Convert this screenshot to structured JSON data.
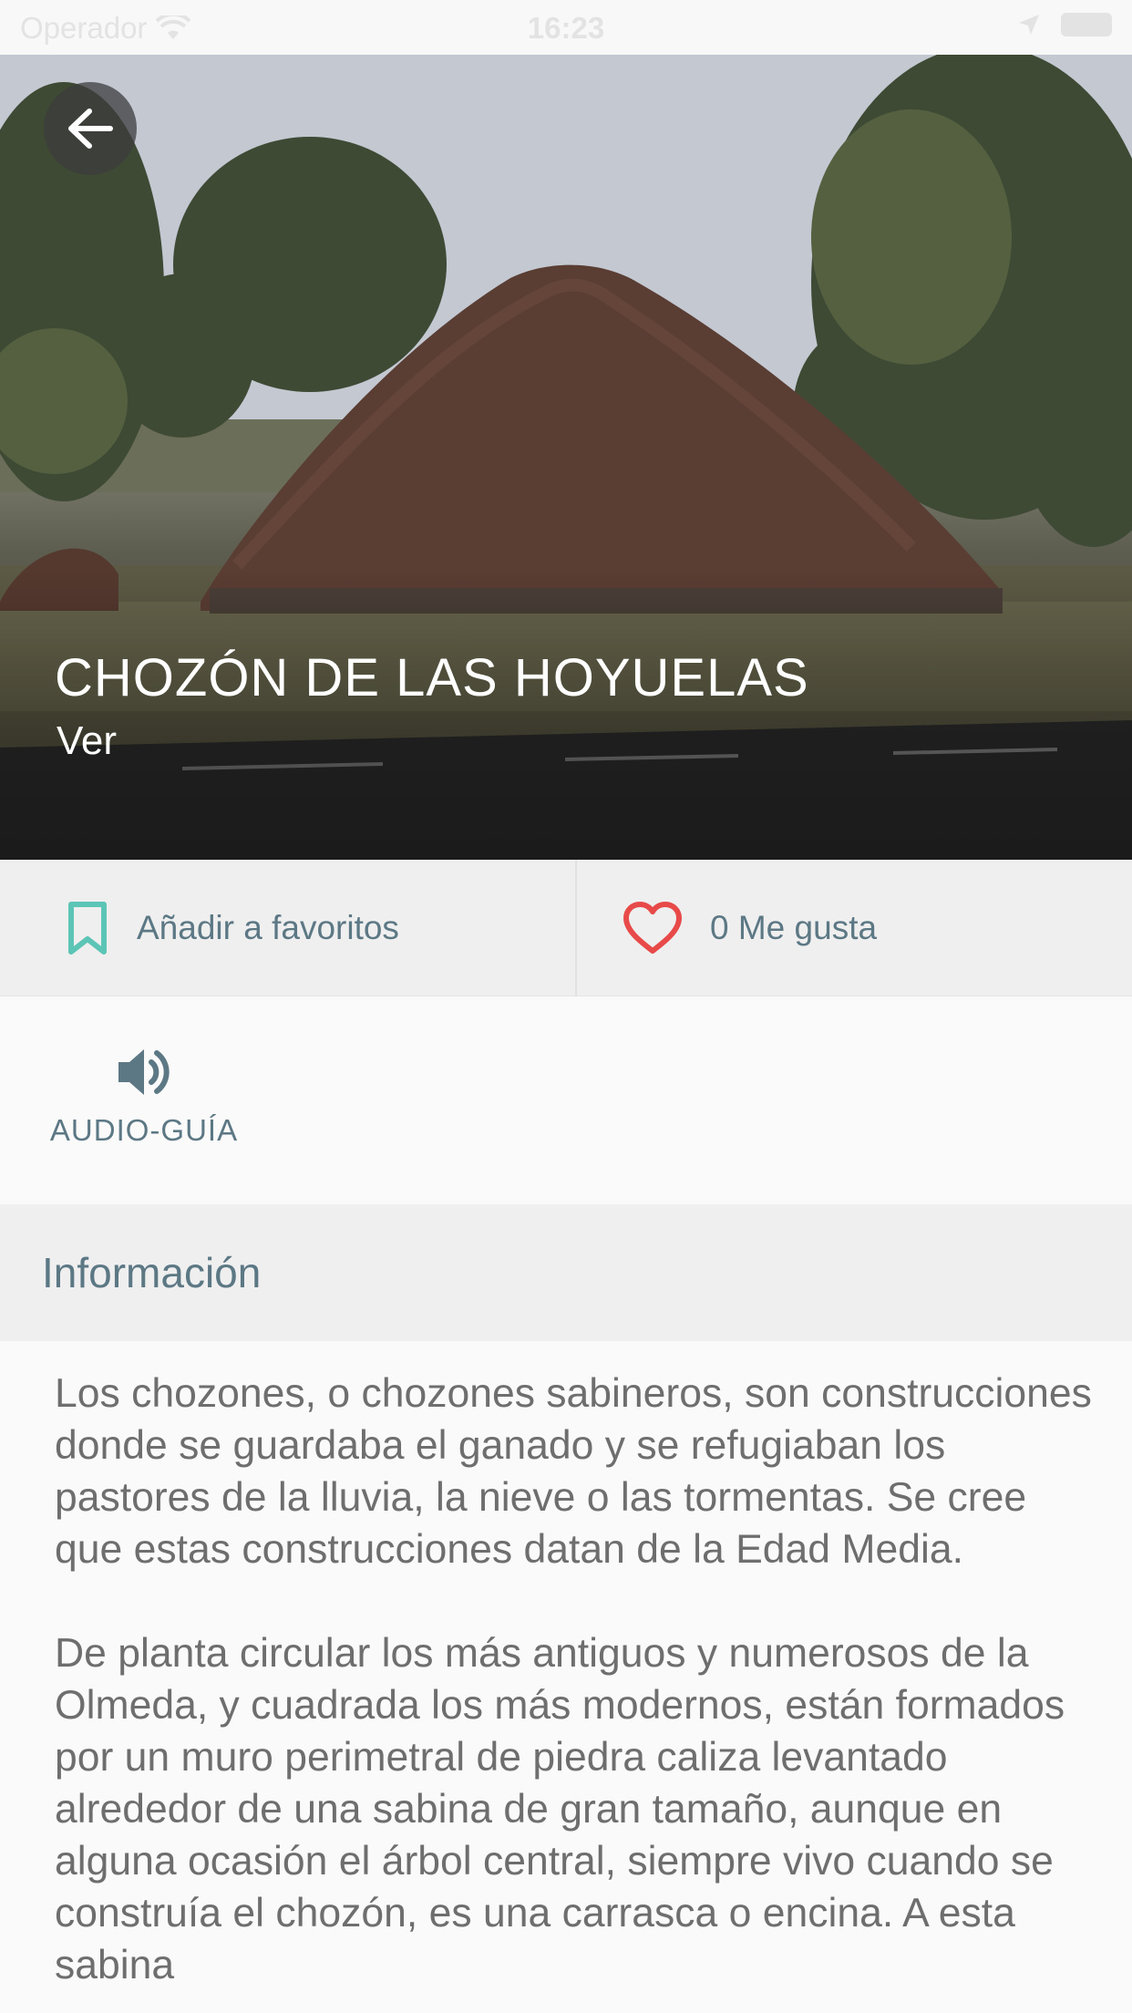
{
  "status_bar": {
    "carrier": "Operador",
    "time": "16:23"
  },
  "place": {
    "title": "CHOZÓN DE LAS HOYUELAS",
    "subtitle": "Ver"
  },
  "actions": {
    "favorite_label": "Añadir a favoritos",
    "like_label": "0 Me gusta"
  },
  "audio_guide": {
    "label": "AUDIO-GUÍA"
  },
  "info_section": {
    "title": "Información"
  },
  "description": {
    "paragraphs": [
      "Los chozones, o chozones sabineros, son construcciones donde se guardaba el ganado y se refugiaban los pastores de la lluvia, la nieve o las tormentas. Se cree que estas construcciones datan de la Edad Media.",
      "De planta circular los más antiguos y numerosos de la Olmeda, y cuadrada los más modernos, están formados por un muro perimetral de piedra caliza levantado alrededor de una sabina de gran tamaño, aunque en alguna ocasión el árbol central, siempre vivo cuando se construía el chozón, es una carrasca o encina. A esta sabina"
    ]
  },
  "colors": {
    "accent_teal": "#5cc5b5",
    "heart_red": "#e84a4a",
    "text_slate": "#5d7885"
  },
  "icons": [
    "back-arrow-icon",
    "bookmark-icon",
    "heart-icon",
    "speaker-icon",
    "wifi-icon",
    "location-icon",
    "battery-icon"
  ]
}
